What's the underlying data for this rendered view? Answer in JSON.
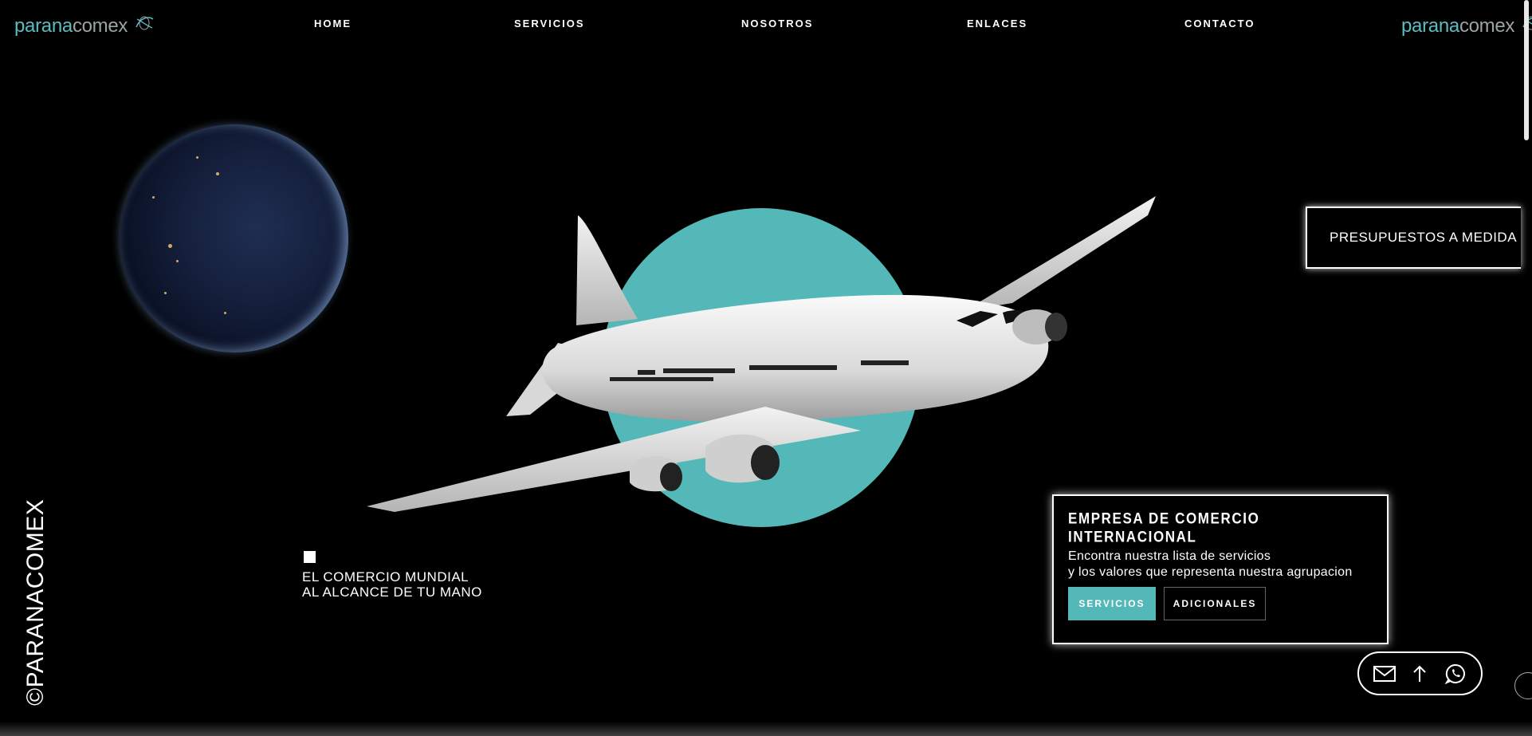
{
  "header": {
    "logo": {
      "part1": "parana",
      "part2": "comex",
      "icon": "globe-swirl-icon"
    },
    "nav": [
      {
        "label": "HOME"
      },
      {
        "label": "SERVICIOS"
      },
      {
        "label": "NOSOTROS"
      },
      {
        "label": "ENLACES"
      },
      {
        "label": "CONTACTO"
      }
    ]
  },
  "hero": {
    "budget_tab": "PRESUPUESTOS A MEDIDA",
    "tagline": {
      "line1": "EL COMERCIO MUNDIAL",
      "line2": "AL ALCANCE DE TU MANO"
    },
    "vertical_copyright": "©PARANACOMEX"
  },
  "info_card": {
    "title": "EMPRESA DE COMERCIO INTERNACIONAL",
    "line1": "Encontra nuestra lista de servicios",
    "line2": "y los valores que representa nuestra agrupacion",
    "primary_button": "SERVICIOS",
    "secondary_button": "ADICIONALES"
  },
  "contact_bar": {
    "icons": [
      "mail-icon",
      "arrow-up-icon",
      "whatsapp-icon"
    ]
  },
  "colors": {
    "accent": "#55b8b8",
    "background": "#000000",
    "logo_grey": "#9aa3a5"
  }
}
